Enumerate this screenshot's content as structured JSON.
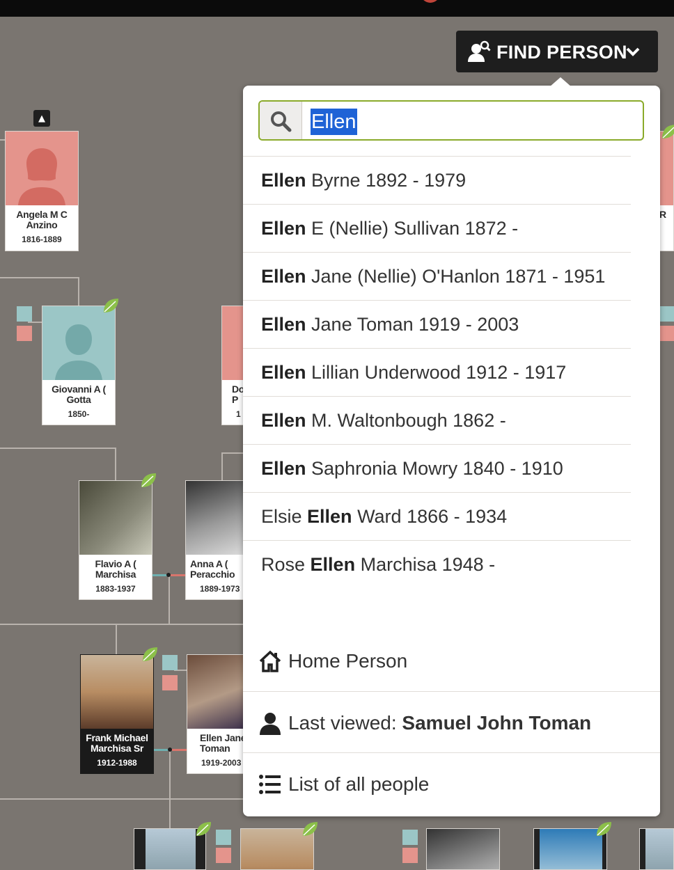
{
  "header": {
    "find_button_label": "FIND PERSON"
  },
  "search": {
    "value": "Ellen"
  },
  "results": [
    {
      "pre": "",
      "match": "Ellen",
      "post": " Byrne 1892 - 1979"
    },
    {
      "pre": "",
      "match": "Ellen",
      "post": " E (Nellie) Sullivan 1872 -"
    },
    {
      "pre": "",
      "match": "Ellen",
      "post": " Jane (Nellie) O'Hanlon 1871 - 1951"
    },
    {
      "pre": "",
      "match": "Ellen",
      "post": " Jane Toman 1919 - 2003"
    },
    {
      "pre": "",
      "match": "Ellen",
      "post": " Lillian Underwood 1912 - 1917"
    },
    {
      "pre": "",
      "match": "Ellen",
      "post": " M. Waltonbough 1862 -"
    },
    {
      "pre": "",
      "match": "Ellen",
      "post": " Saphronia Mowry 1840 - 1910"
    },
    {
      "pre": "Elsie ",
      "match": "Ellen",
      "post": " Ward 1866 - 1934"
    },
    {
      "pre": "Rose ",
      "match": "Ellen",
      "post": " Marchisa 1948 -"
    }
  ],
  "options": {
    "home": "Home Person",
    "last_viewed_prefix": "Last viewed: ",
    "last_viewed_name": "Samuel John Toman",
    "list_all": "List of all people"
  },
  "tree": {
    "cards": [
      {
        "name": "Angela M C Anzino",
        "dates": "1816-1889"
      },
      {
        "name": "Giovanni A ( Gotta",
        "dates": "1850-"
      },
      {
        "name": "Do P",
        "dates": "1"
      },
      {
        "name": "Flavio A ( Marchisa",
        "dates": "1883-1937"
      },
      {
        "name": "Anna A ( Peracchio",
        "dates": "1889-1973"
      },
      {
        "name": "Frank Michael Marchisa Sr",
        "dates": "1912-1988"
      },
      {
        "name": "Ellen Jane Toman",
        "dates": "1919-2003"
      },
      {
        "name": "R",
        "dates": ""
      }
    ]
  },
  "colors": {
    "background": "#7a7570",
    "female": "#e4948c",
    "male": "#9bc6c6",
    "search_border": "#8aaa2a",
    "selection": "#1f63d6"
  },
  "icons": [
    "search-icon",
    "person-search-icon",
    "chevron-down-icon",
    "home-icon",
    "person-icon",
    "list-icon",
    "leaf-icon",
    "collapse-up-icon"
  ]
}
